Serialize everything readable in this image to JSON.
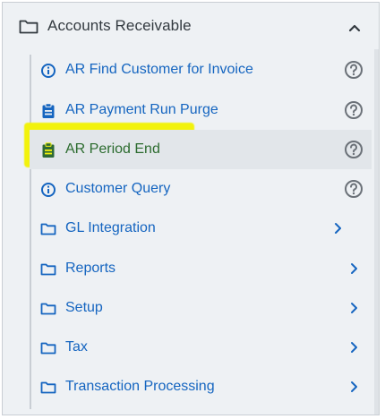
{
  "section": {
    "title": "Accounts Receivable",
    "expanded": true,
    "icon": "folder-icon",
    "toggle_icon": "chevron-up-icon"
  },
  "items": [
    {
      "label": "AR Find Customer for Invoice",
      "icon": "info-circle-icon",
      "trailing": "help-icon",
      "kind": "query"
    },
    {
      "label": "AR Payment Run Purge",
      "icon": "clipboard-icon",
      "trailing": "help-icon",
      "kind": "process"
    },
    {
      "label": "AR Period End",
      "icon": "clipboard-icon",
      "trailing": "help-icon",
      "kind": "process",
      "highlighted": true
    },
    {
      "label": "Customer Query",
      "icon": "info-circle-icon",
      "trailing": "help-icon",
      "kind": "query"
    },
    {
      "label": "GL Integration",
      "icon": "folder-icon",
      "trailing": "chevron-right-icon",
      "kind": "folder"
    },
    {
      "label": "Reports",
      "icon": "folder-icon",
      "trailing": "chevron-right-icon",
      "kind": "folder"
    },
    {
      "label": "Setup",
      "icon": "folder-icon",
      "trailing": "chevron-right-icon",
      "kind": "folder"
    },
    {
      "label": "Tax",
      "icon": "folder-icon",
      "trailing": "chevron-right-icon",
      "kind": "folder"
    },
    {
      "label": "Transaction Processing",
      "icon": "folder-icon",
      "trailing": "chevron-right-icon",
      "kind": "folder"
    }
  ],
  "colors": {
    "link": "#1565c0",
    "icon": "#1565c0",
    "help_icon": "#6b7178",
    "highlight": "#f2f20c",
    "panel_bg": "#eef1f4"
  }
}
